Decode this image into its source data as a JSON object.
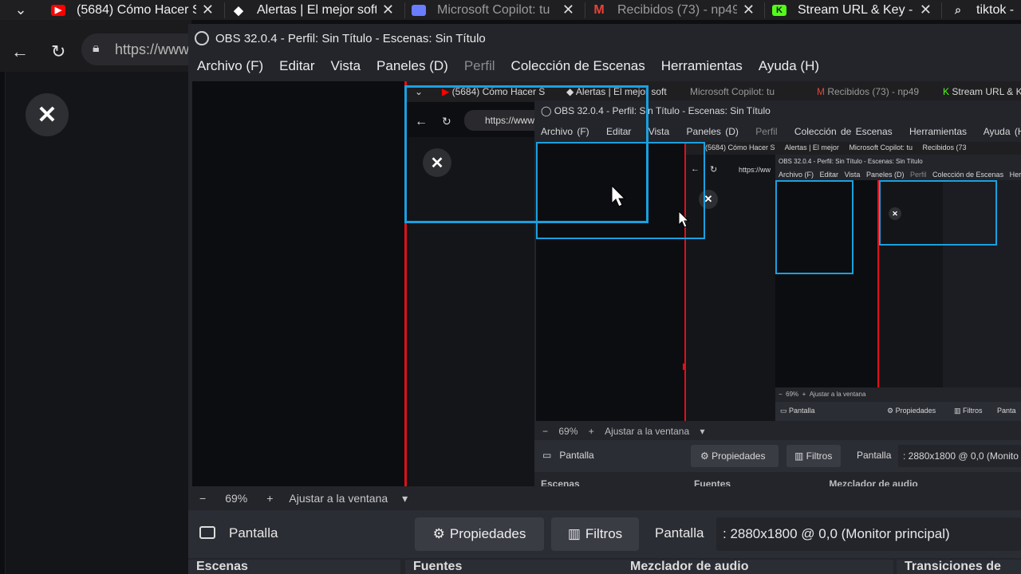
{
  "browser": {
    "tabs": [
      {
        "title": "(5684) Cómo Hacer S",
        "icon": "youtube-icon",
        "color": "#ff0000"
      },
      {
        "title": "Alertas | El mejor soft",
        "icon": "streamelements-icon",
        "color": "#ffffff"
      },
      {
        "title": "Microsoft Copilot: tu",
        "icon": "copilot-icon",
        "color": "#6a7cff"
      },
      {
        "title": "Recibidos (73) - np49",
        "icon": "gmail-icon",
        "color": "#ea4335"
      },
      {
        "title": "Stream URL & Key - K",
        "icon": "kick-icon",
        "color": "#53fc18"
      },
      {
        "title": "tiktok -",
        "icon": "search-icon",
        "color": "#ffffff"
      }
    ],
    "url": "https://www"
  },
  "obs": {
    "title": "OBS 32.0.4 - Perfil: Sin Título - Escenas: Sin Título",
    "menu": [
      "Archivo (F)",
      "Editar",
      "Vista",
      "Paneles (D)",
      "Perfil",
      "Colección de Escenas",
      "Herramientas",
      "Ayuda (H)"
    ],
    "zoom": {
      "minus": "−",
      "value": "69%",
      "plus": "+",
      "fit": "Ajustar a la ventana"
    },
    "source": {
      "name": "Pantalla",
      "properties": "Propiedades",
      "filters": "Filtros",
      "label": "Pantalla",
      "value": ": 2880x1800 @ 0,0 (Monitor principal)"
    },
    "docks": [
      "Escenas",
      "Fuentes",
      "Mezclador de audio",
      "Transiciones de"
    ]
  },
  "nested1": {
    "tabs": [
      "(5684) Cómo Hacer S",
      "Alertas | El mejor soft",
      "Microsoft Copilot: tu",
      "Recibidos (73) - np49",
      "Stream URL & Ke"
    ],
    "url": "https://www",
    "title": "OBS 32.0.4 - Perfil: Sin Título - Escenas: Sin Título",
    "menu": [
      "Archivo (F)",
      "Editar",
      "Vista",
      "Paneles (D)",
      "Perfil",
      "Colección de Escenas",
      "Herramientas",
      "Ayuda (H)"
    ],
    "zoom": "69%",
    "fit": "Ajustar a la ventana",
    "source": "Pantalla",
    "properties": "Propiedades",
    "filters": "Filtros",
    "label": "Pantalla",
    "value": ": 2880x1800 @ 0,0 (Monito",
    "docks": [
      "Escenas",
      "Fuentes",
      "Mezclador de audio"
    ]
  },
  "nested2": {
    "tabs": [
      "(5684) Cómo Hacer S",
      "Alertas | El mejor",
      "Microsoft Copilot: tu",
      "Recibidos (73"
    ],
    "url": "https://ww",
    "title": "OBS 32.0.4 - Perfil: Sin Título - Escenas: Sin Título",
    "menu": [
      "Archivo (F)",
      "Editar",
      "Vista",
      "Paneles (D)",
      "Perfil",
      "Colección de Escenas",
      "Herra"
    ],
    "zoom": "69%",
    "fit": "Ajustar a la ventana",
    "source": "Pantalla",
    "properties": "Propiedades",
    "filters": "Filtros",
    "label": "Panta"
  }
}
